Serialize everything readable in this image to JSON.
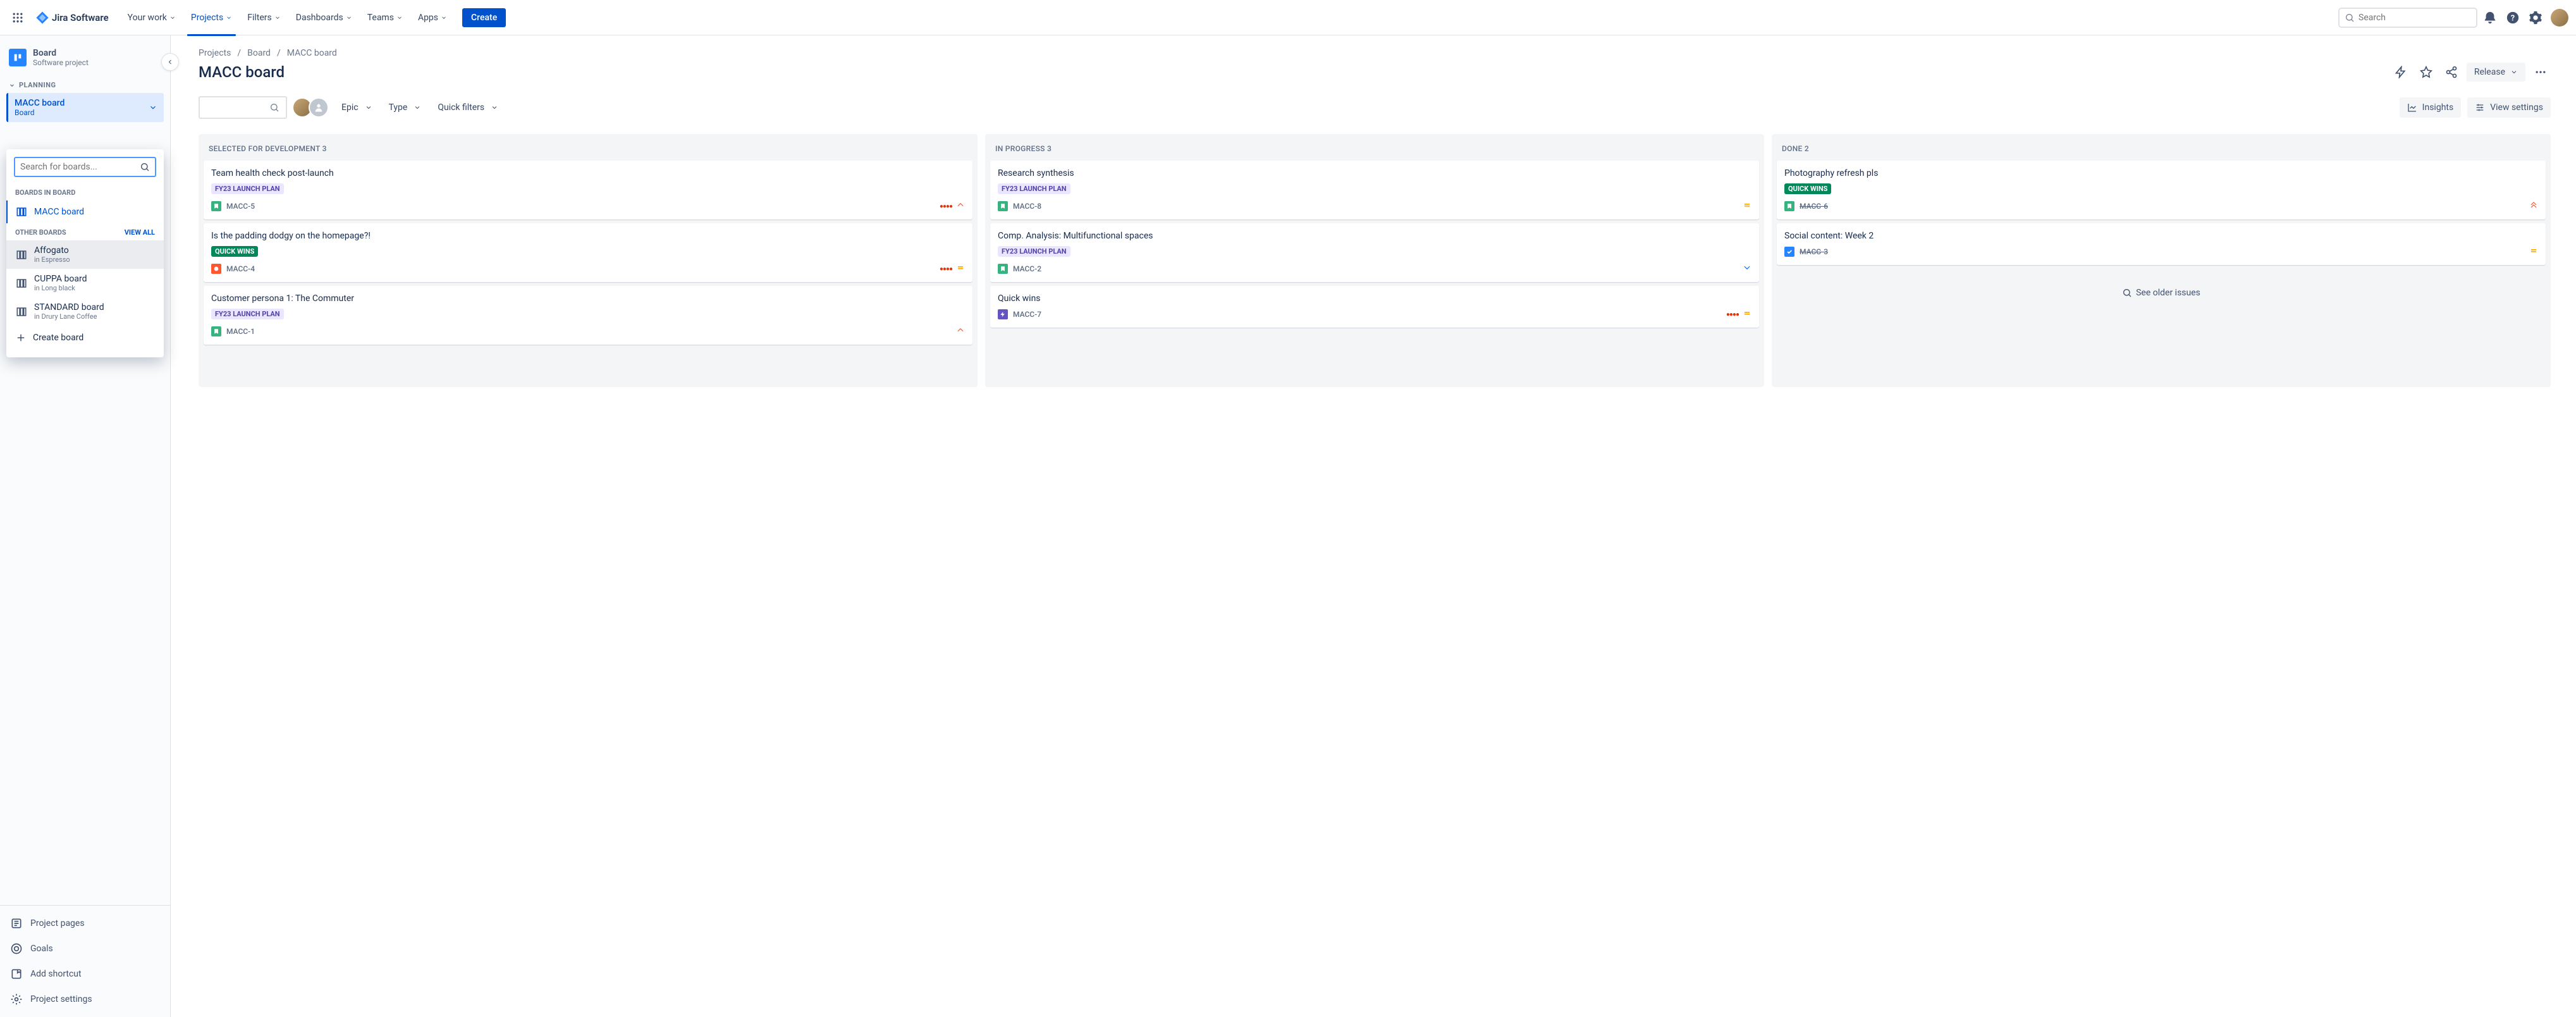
{
  "nav": {
    "logo": "Jira Software",
    "items": [
      "Your work",
      "Projects",
      "Filters",
      "Dashboards",
      "Teams",
      "Apps"
    ],
    "active_index": 1,
    "create": "Create",
    "search_placeholder": "Search"
  },
  "sidebar": {
    "project_name": "Board",
    "project_type": "Software project",
    "section_planning": "PLANNING",
    "current_board_name": "MACC board",
    "current_board_sub": "Board",
    "links": [
      "Project pages",
      "Goals",
      "Add shortcut",
      "Project settings"
    ]
  },
  "dropdown": {
    "search_placeholder": "Search for boards...",
    "section1": "BOARDS IN BOARD",
    "boards_in": [
      {
        "name": "MACC board"
      }
    ],
    "section2": "OTHER BOARDS",
    "view_all": "VIEW ALL",
    "other": [
      {
        "name": "Affogato",
        "sub": "in Espresso"
      },
      {
        "name": "CUPPA board",
        "sub": "in Long black"
      },
      {
        "name": "STANDARD board",
        "sub": "in Drury Lane Coffee"
      }
    ],
    "create": "Create board"
  },
  "page": {
    "crumbs": [
      "Projects",
      "Board",
      "MACC board"
    ],
    "title": "MACC board",
    "release": "Release",
    "insights": "Insights",
    "view_settings": "View settings",
    "filters": {
      "epic": "Epic",
      "type": "Type",
      "quick": "Quick filters"
    }
  },
  "columns": [
    {
      "title": "SELECTED FOR DEVELOPMENT",
      "count": 3,
      "cards": [
        {
          "title": "Team health check post-launch",
          "tag": "FY23 LAUNCH PLAN",
          "tag_style": "purple",
          "type": "story",
          "key": "MACC-5",
          "dots": true,
          "prio": "high"
        },
        {
          "title": "Is the padding dodgy on the homepage?!",
          "tag": "QUICK WINS",
          "tag_style": "teal",
          "type": "bug",
          "key": "MACC-4",
          "dots": true,
          "prio": "medium"
        },
        {
          "title": "Customer persona 1: The Commuter",
          "tag": "FY23 LAUNCH PLAN",
          "tag_style": "purple",
          "type": "story",
          "key": "MACC-1",
          "prio": "high"
        }
      ]
    },
    {
      "title": "IN PROGRESS",
      "count": 3,
      "cards": [
        {
          "title": "Research synthesis",
          "tag": "FY23 LAUNCH PLAN",
          "tag_style": "purple",
          "type": "story",
          "key": "MACC-8",
          "prio": "medium"
        },
        {
          "title": "Comp. Analysis: Multifunctional spaces",
          "tag": "FY23 LAUNCH PLAN",
          "tag_style": "purple",
          "type": "story",
          "key": "MACC-2",
          "prio": "low"
        },
        {
          "title": "Quick wins",
          "type": "epic",
          "key": "MACC-7",
          "dots": true,
          "prio": "medium"
        }
      ]
    },
    {
      "title": "DONE",
      "count": 2,
      "cards": [
        {
          "title": "Photography refresh pls",
          "tag": "QUICK WINS",
          "tag_style": "teal",
          "type": "story",
          "key": "MACC-6",
          "done": true,
          "prio": "highest"
        },
        {
          "title": "Social content: Week 2",
          "type": "task",
          "key": "MACC-3",
          "done": true,
          "prio": "medium"
        }
      ],
      "see_older": "See older issues"
    }
  ]
}
